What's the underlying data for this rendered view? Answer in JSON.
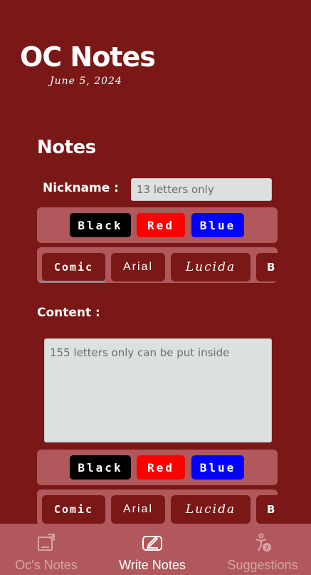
{
  "header": {
    "title": "OC Notes",
    "date": "June 5, 2024"
  },
  "notes": {
    "title": "Notes",
    "nickname": {
      "label": "Nickname :",
      "placeholder": "13 letters only",
      "value": ""
    },
    "content": {
      "label": "Content :",
      "placeholder": "155 letters only can be put inside",
      "value": ""
    }
  },
  "color_options": [
    "Black",
    "Red",
    "Blue"
  ],
  "font_options": [
    "Comic",
    "Arial",
    "Lucida",
    "B"
  ],
  "colors": {
    "background": "#7a1818",
    "panel": "#b0585c",
    "black": "#000000",
    "red": "#ff0000",
    "blue": "#0000ff",
    "input_bg": "#dce0e0"
  },
  "bottom_nav": {
    "items": [
      {
        "label": "Oc's Notes",
        "icon": "note-icon",
        "active": false
      },
      {
        "label": "Write Notes",
        "icon": "write-icon",
        "active": true
      },
      {
        "label": "Suggestions",
        "icon": "suggestions-icon",
        "active": false
      }
    ]
  }
}
